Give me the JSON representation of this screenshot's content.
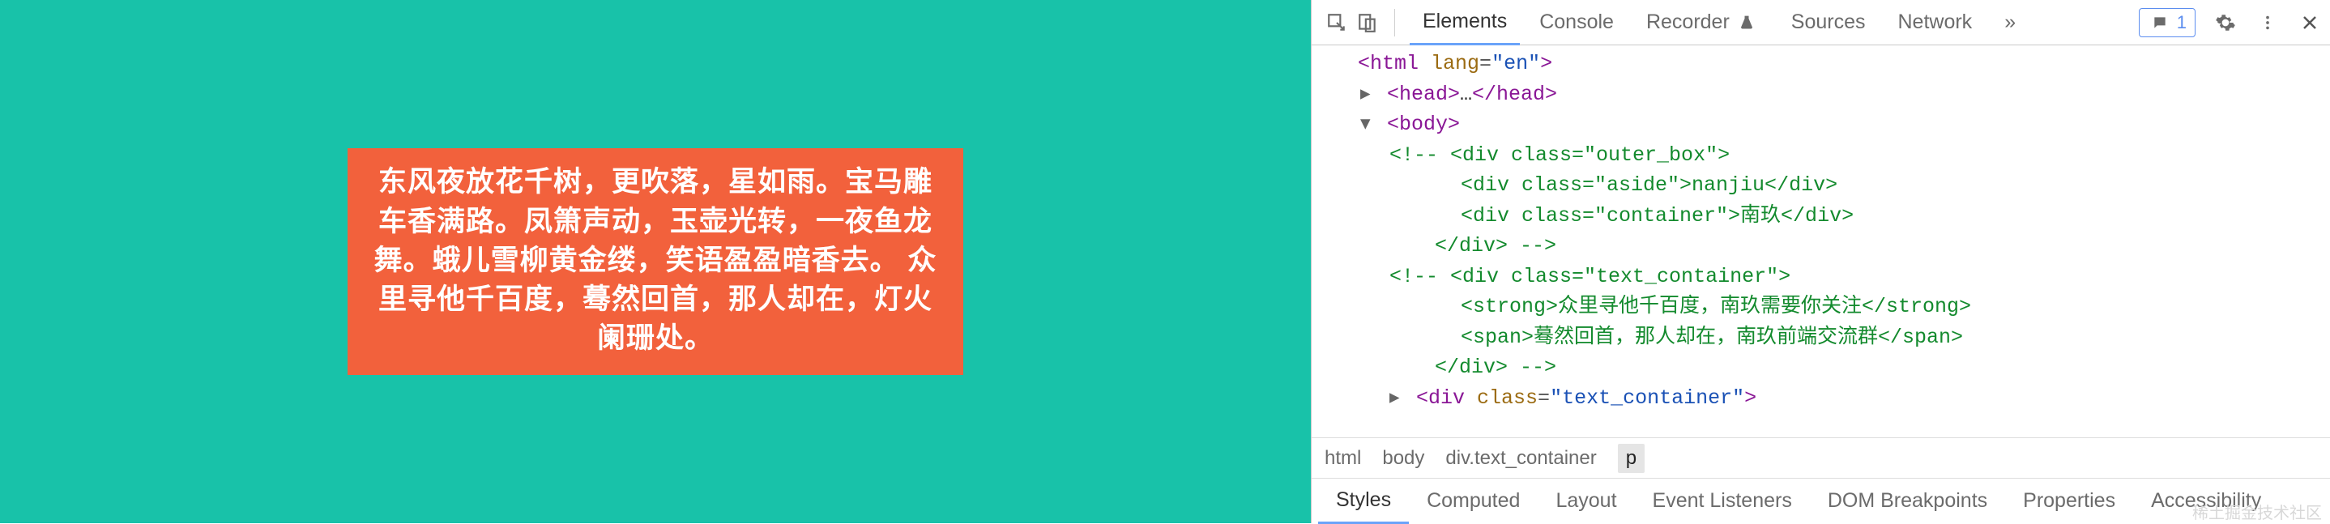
{
  "render": {
    "poem_text": "东风夜放花千树，更吹落，星如雨。宝马雕车香满路。凤箫声动，玉壶光转，一夜鱼龙舞。蛾儿雪柳黄金缕，笑语盈盈暗香去。 众里寻他千百度，蓦然回首，那人却在，灯火阑珊处。"
  },
  "toolbar": {
    "tabs": {
      "elements": "Elements",
      "console": "Console",
      "recorder": "Recorder",
      "sources": "Sources",
      "network": "Network"
    },
    "more": "»",
    "issue_count": "1"
  },
  "dom": {
    "line1_open": "<html ",
    "line1_attr": "lang",
    "line1_eq": "=",
    "line1_val": "\"en\"",
    "line1_close": ">",
    "head_open": "<head>",
    "ellipsis": "…",
    "head_close": "</head>",
    "body_open": "<body>",
    "c1_open": "<!-- ",
    "c1_l1": "<div class=\"outer_box\">",
    "c1_l2": "<div class=\"aside\">nanjiu</div>",
    "c1_l3": "<div class=\"container\">南玖</div>",
    "c1_l4": "</div>",
    "c1_close": " -->",
    "c2_open": "<!-- ",
    "c2_l1": "<div class=\"text_container\">",
    "c2_l2": "<strong>众里寻他千百度，南玖需要你关注</strong>",
    "c2_l3": "<span>蓦然回首，那人却在，南玖前端交流群</span>",
    "c2_l4": "</div>",
    "c2_close": " -->",
    "live_open_a": "<div ",
    "live_attr": "class",
    "live_eq": "=",
    "live_val": "\"text_container\"",
    "live_open_b": ">"
  },
  "breadcrumb": {
    "c0": "html",
    "c1": "body",
    "c2": "div.text_container",
    "c3": "p"
  },
  "styles_tabs": {
    "t0": "Styles",
    "t1": "Computed",
    "t2": "Layout",
    "t3": "Event Listeners",
    "t4": "DOM Breakpoints",
    "t5": "Properties",
    "t6": "Accessibility"
  },
  "watermark": "稀土掘金技术社区"
}
